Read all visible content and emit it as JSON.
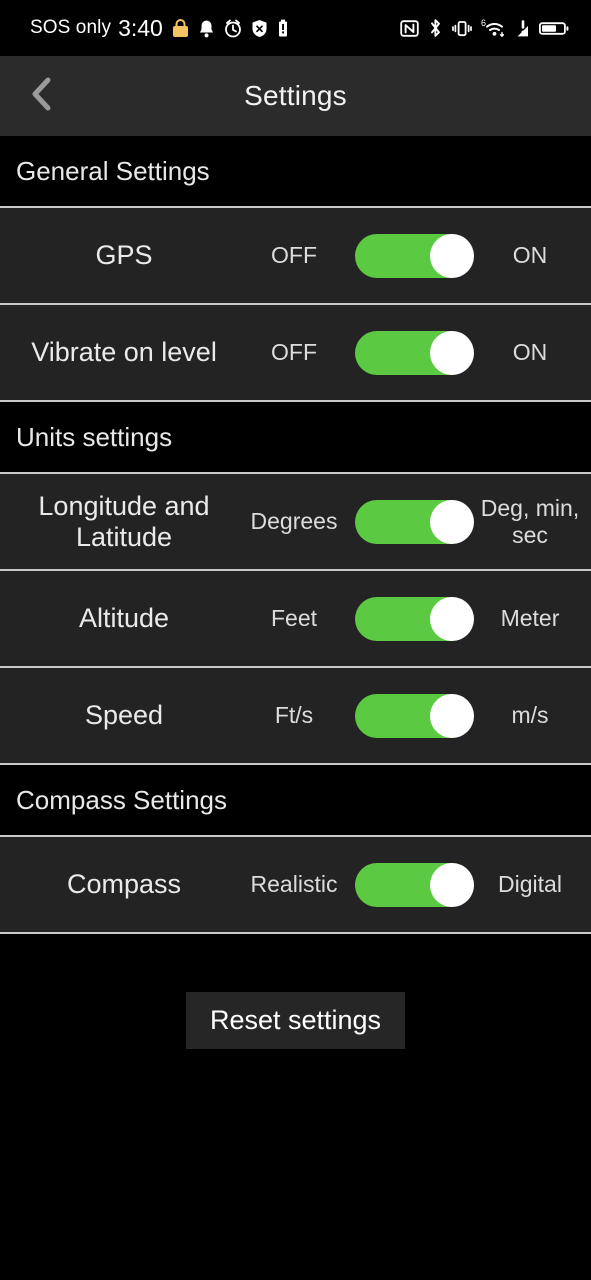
{
  "status_bar": {
    "carrier": "SOS only",
    "time": "3:40",
    "left_icons": [
      "lock-icon",
      "bell-icon",
      "alarm-icon",
      "shield-x-icon",
      "battery-saver-icon"
    ],
    "right_icons": [
      "nfc-icon",
      "bluetooth-icon",
      "vibrate-icon",
      "wifi-6-icon",
      "signal-warning-icon",
      "battery-icon"
    ]
  },
  "header": {
    "title": "Settings",
    "back_icon": "chevron-left-icon"
  },
  "sections": [
    {
      "title": "General Settings",
      "rows": [
        {
          "label": "GPS",
          "left_option": "OFF",
          "right_option": "ON",
          "toggle_on": true
        },
        {
          "label": "Vibrate on level",
          "left_option": "OFF",
          "right_option": "ON",
          "toggle_on": true
        }
      ]
    },
    {
      "title": "Units settings",
      "rows": [
        {
          "label": "Longitude and Latitude",
          "left_option": "Degrees",
          "right_option": "Deg, min, sec",
          "toggle_on": true
        },
        {
          "label": "Altitude",
          "left_option": "Feet",
          "right_option": "Meter",
          "toggle_on": true
        },
        {
          "label": "Speed",
          "left_option": "Ft/s",
          "right_option": "m/s",
          "toggle_on": true
        }
      ]
    },
    {
      "title": "Compass Settings",
      "rows": [
        {
          "label": "Compass",
          "left_option": "Realistic",
          "right_option": "Digital",
          "toggle_on": true
        }
      ]
    }
  ],
  "reset": {
    "label": "Reset settings"
  },
  "colors": {
    "toggle_on": "#5cc942",
    "knob": "#ffffff",
    "row_bg": "#232323",
    "section_bg": "#000000",
    "header_bg": "#2b2b2b",
    "divider": "#c9c9c9"
  }
}
